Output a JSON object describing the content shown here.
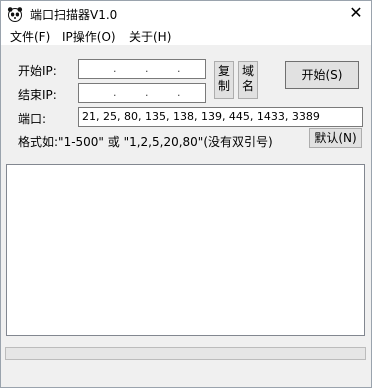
{
  "window": {
    "title": "端口扫描器V1.0",
    "close_glyph": "✕"
  },
  "menu": {
    "items": [
      {
        "label": "文件(F)"
      },
      {
        "label": "IP操作(O)"
      },
      {
        "label": "关于(H)"
      }
    ]
  },
  "form": {
    "start_ip_label": "开始IP:",
    "end_ip_label": "结束IP:",
    "ip_dot": ".",
    "copy_button": "复制",
    "domain_button": "域名",
    "start_button": "开始(S)",
    "port_label": "端口:",
    "port_value": "21, 25, 80, 135, 138, 139, 445, 1433, 3389",
    "format_hint": "格式如:\"1-500\" 或 \"1,2,5,20,80\"(没有双引号)",
    "default_button": "默认(N)"
  },
  "progress": {
    "value": 0
  },
  "icons": {
    "app": "panda-icon"
  }
}
